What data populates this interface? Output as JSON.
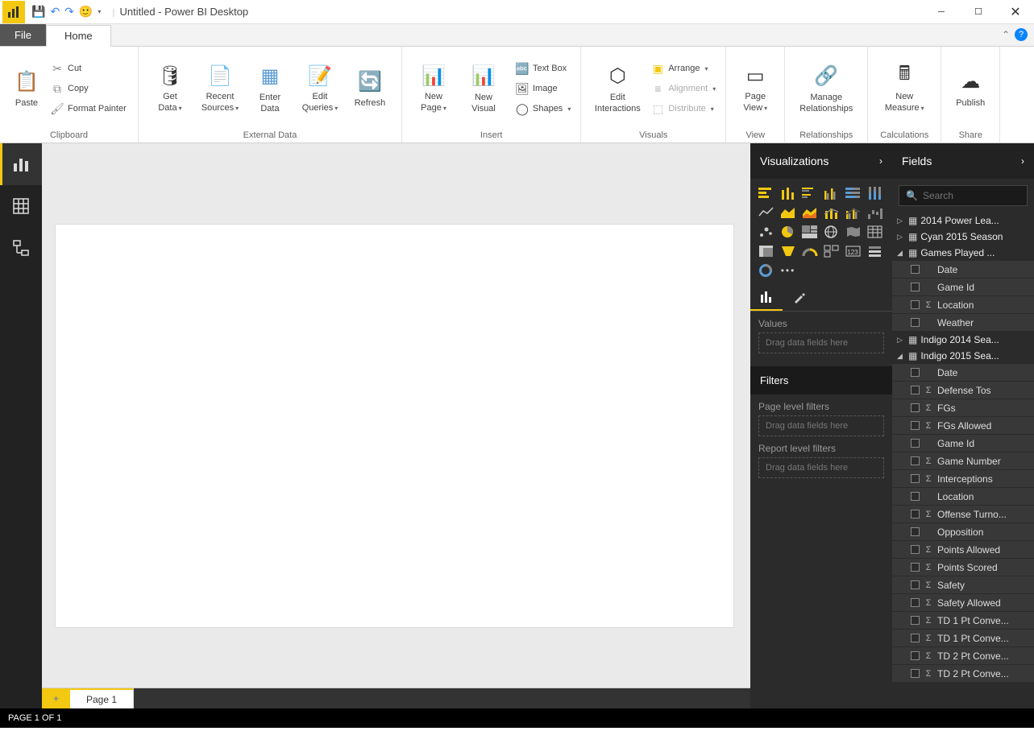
{
  "titlebar": {
    "title": "Untitled - Power BI Desktop"
  },
  "tabs": {
    "file": "File",
    "home": "Home"
  },
  "ribbon": {
    "clipboard": {
      "label": "Clipboard",
      "paste": "Paste",
      "cut": "Cut",
      "copy": "Copy",
      "fp": "Format Painter"
    },
    "external": {
      "label": "External Data",
      "getdata": "Get\nData",
      "recent": "Recent\nSources",
      "enter": "Enter\nData",
      "edit": "Edit\nQueries",
      "refresh": "Refresh"
    },
    "insert": {
      "label": "Insert",
      "newpage": "New\nPage",
      "newvisual": "New\nVisual",
      "textbox": "Text Box",
      "image": "Image",
      "shapes": "Shapes"
    },
    "visuals": {
      "label": "Visuals",
      "editint": "Edit\nInteractions",
      "arrange": "Arrange",
      "align": "Alignment",
      "dist": "Distribute"
    },
    "view": {
      "label": "View",
      "pageview": "Page\nView"
    },
    "rel": {
      "label": "Relationships",
      "manage": "Manage\nRelationships"
    },
    "calc": {
      "label": "Calculations",
      "newmeasure": "New\nMeasure"
    },
    "share": {
      "label": "Share",
      "publish": "Publish"
    }
  },
  "viz": {
    "header": "Visualizations",
    "values": "Values",
    "drag": "Drag data fields here",
    "filters": "Filters",
    "pagefilters": "Page level filters",
    "reportfilters": "Report level filters"
  },
  "fields": {
    "header": "Fields",
    "search_ph": "Search",
    "tables": [
      {
        "name": "2014 Power Lea...",
        "expanded": false
      },
      {
        "name": "Cyan 2015 Season",
        "expanded": false
      },
      {
        "name": "Games Played ...",
        "expanded": true,
        "fields": [
          {
            "name": "Date",
            "sigma": false
          },
          {
            "name": "Game Id",
            "sigma": false
          },
          {
            "name": "Location",
            "sigma": true
          },
          {
            "name": "Weather",
            "sigma": false
          }
        ]
      },
      {
        "name": "Indigo 2014 Sea...",
        "expanded": false
      },
      {
        "name": "Indigo 2015 Sea...",
        "expanded": true,
        "fields": [
          {
            "name": "Date",
            "sigma": false
          },
          {
            "name": "Defense Tos",
            "sigma": true
          },
          {
            "name": "FGs",
            "sigma": true
          },
          {
            "name": "FGs Allowed",
            "sigma": true
          },
          {
            "name": "Game Id",
            "sigma": false
          },
          {
            "name": "Game Number",
            "sigma": true
          },
          {
            "name": "Interceptions",
            "sigma": true
          },
          {
            "name": "Location",
            "sigma": false
          },
          {
            "name": "Offense Turno...",
            "sigma": true
          },
          {
            "name": "Opposition",
            "sigma": false
          },
          {
            "name": "Points Allowed",
            "sigma": true
          },
          {
            "name": "Points Scored",
            "sigma": true
          },
          {
            "name": "Safety",
            "sigma": true
          },
          {
            "name": "Safety Allowed",
            "sigma": true
          },
          {
            "name": "TD 1 Pt Conve...",
            "sigma": true
          },
          {
            "name": "TD 1 Pt Conve...",
            "sigma": true
          },
          {
            "name": "TD 2 Pt Conve...",
            "sigma": true
          },
          {
            "name": "TD 2 Pt Conve...",
            "sigma": true
          }
        ]
      }
    ]
  },
  "pagetab": "Page 1",
  "status": "PAGE 1 OF 1"
}
